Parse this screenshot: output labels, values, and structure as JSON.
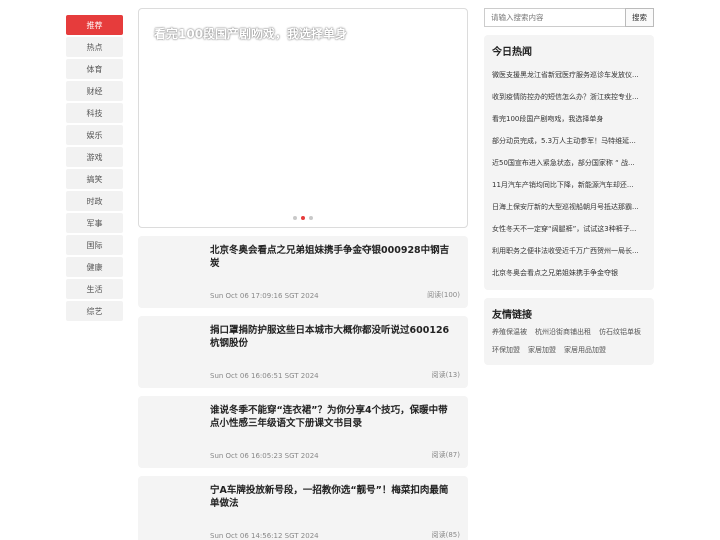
{
  "nav": {
    "items": [
      "推荐",
      "热点",
      "体育",
      "财经",
      "科技",
      "娱乐",
      "游戏",
      "搞笑",
      "时政",
      "军事",
      "国际",
      "健康",
      "生活",
      "综艺"
    ],
    "active_index": 0
  },
  "banner": {
    "title": "看完100段国产剧吻戏，我选择单身",
    "slides": 3,
    "active_slide": 1
  },
  "articles": [
    {
      "title": "北京冬奥会看点之兄弟姐妹携手争金夺银000928中钢吉炭",
      "date": "Sun Oct 06 17:09:16 SGT 2024",
      "reads": "阅读(100)"
    },
    {
      "title": "捐口罩捐防护服这些日本城市大概你都没听说过600126杭钢股份",
      "date": "Sun Oct 06 16:06:51 SGT 2024",
      "reads": "阅读(13)"
    },
    {
      "title": "谁说冬季不能穿“连衣裙”？为你分享4个技巧，保暖中带点小性感三年级语文下册课文书目录",
      "date": "Sun Oct 06 16:05:23 SGT 2024",
      "reads": "阅读(87)"
    },
    {
      "title": "宁A车牌投放新号段，一招教你选“靓号”！梅菜扣肉最简单做法",
      "date": "Sun Oct 06 14:56:12 SGT 2024",
      "reads": "阅读(85)"
    }
  ],
  "search": {
    "placeholder": "请输入搜索内容",
    "button": "搜索"
  },
  "hot": {
    "title": "今日热闻",
    "items": [
      "微医支援黑龙江省新冠医疗服务巡诊车发放仪...",
      "收到疫情防控办的短信怎么办？浙江疾控专业...",
      "看完100段国产剧吻戏，我选择单身",
      "部分动员完成，5.3万人主动参军！马特维延...",
      "近50国宣布进入紧急状态，部分国家称 “ 战...",
      "11月汽车产销均同比下降，新能源汽车却还...",
      "日海上保安厅新的大型巡视船朝月号抵达那霸...",
      "女性冬天不一定穿“阔腿裤”，试试这3种裤子...",
      "利用职务之便非法收受近千万广西贺州一局长...",
      "北京冬奥会看点之兄弟姐妹携手争金夺银"
    ]
  },
  "friends": {
    "title": "友情链接",
    "links": [
      "养殖保温被",
      "杭州沿街商铺出租",
      "仿石纹铝单板",
      "环保加盟",
      "家居加盟",
      "家居用品加盟"
    ]
  }
}
